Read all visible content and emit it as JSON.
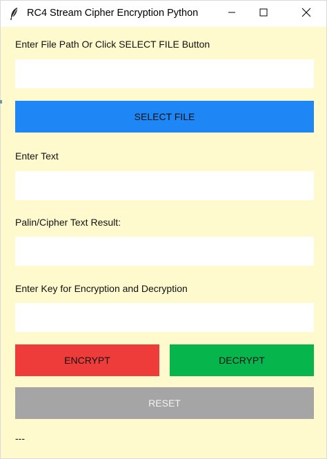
{
  "window": {
    "title": "RC4 Stream Cipher Encryption Python",
    "icon": "feather-icon",
    "controls": [
      "minimize-icon",
      "maximize-icon",
      "close-icon"
    ]
  },
  "file": {
    "label": "Enter File Path Or Click SELECT FILE Button",
    "value": "",
    "button_label": "SELECT FILE"
  },
  "text": {
    "label": "Enter Text",
    "value": ""
  },
  "result": {
    "label": "Palin/Cipher Text Result:",
    "value": ""
  },
  "key": {
    "label": "Enter Key for Encryption and Decryption",
    "value": ""
  },
  "actions": {
    "encrypt_label": "ENCRYPT",
    "decrypt_label": "DECRYPT",
    "reset_label": "RESET"
  },
  "status": "---",
  "colors": {
    "background": "#fffacd",
    "select": "#1e86f5",
    "encrypt": "#ee3c3a",
    "decrypt": "#06b54c",
    "reset": "#a5a5a5"
  }
}
